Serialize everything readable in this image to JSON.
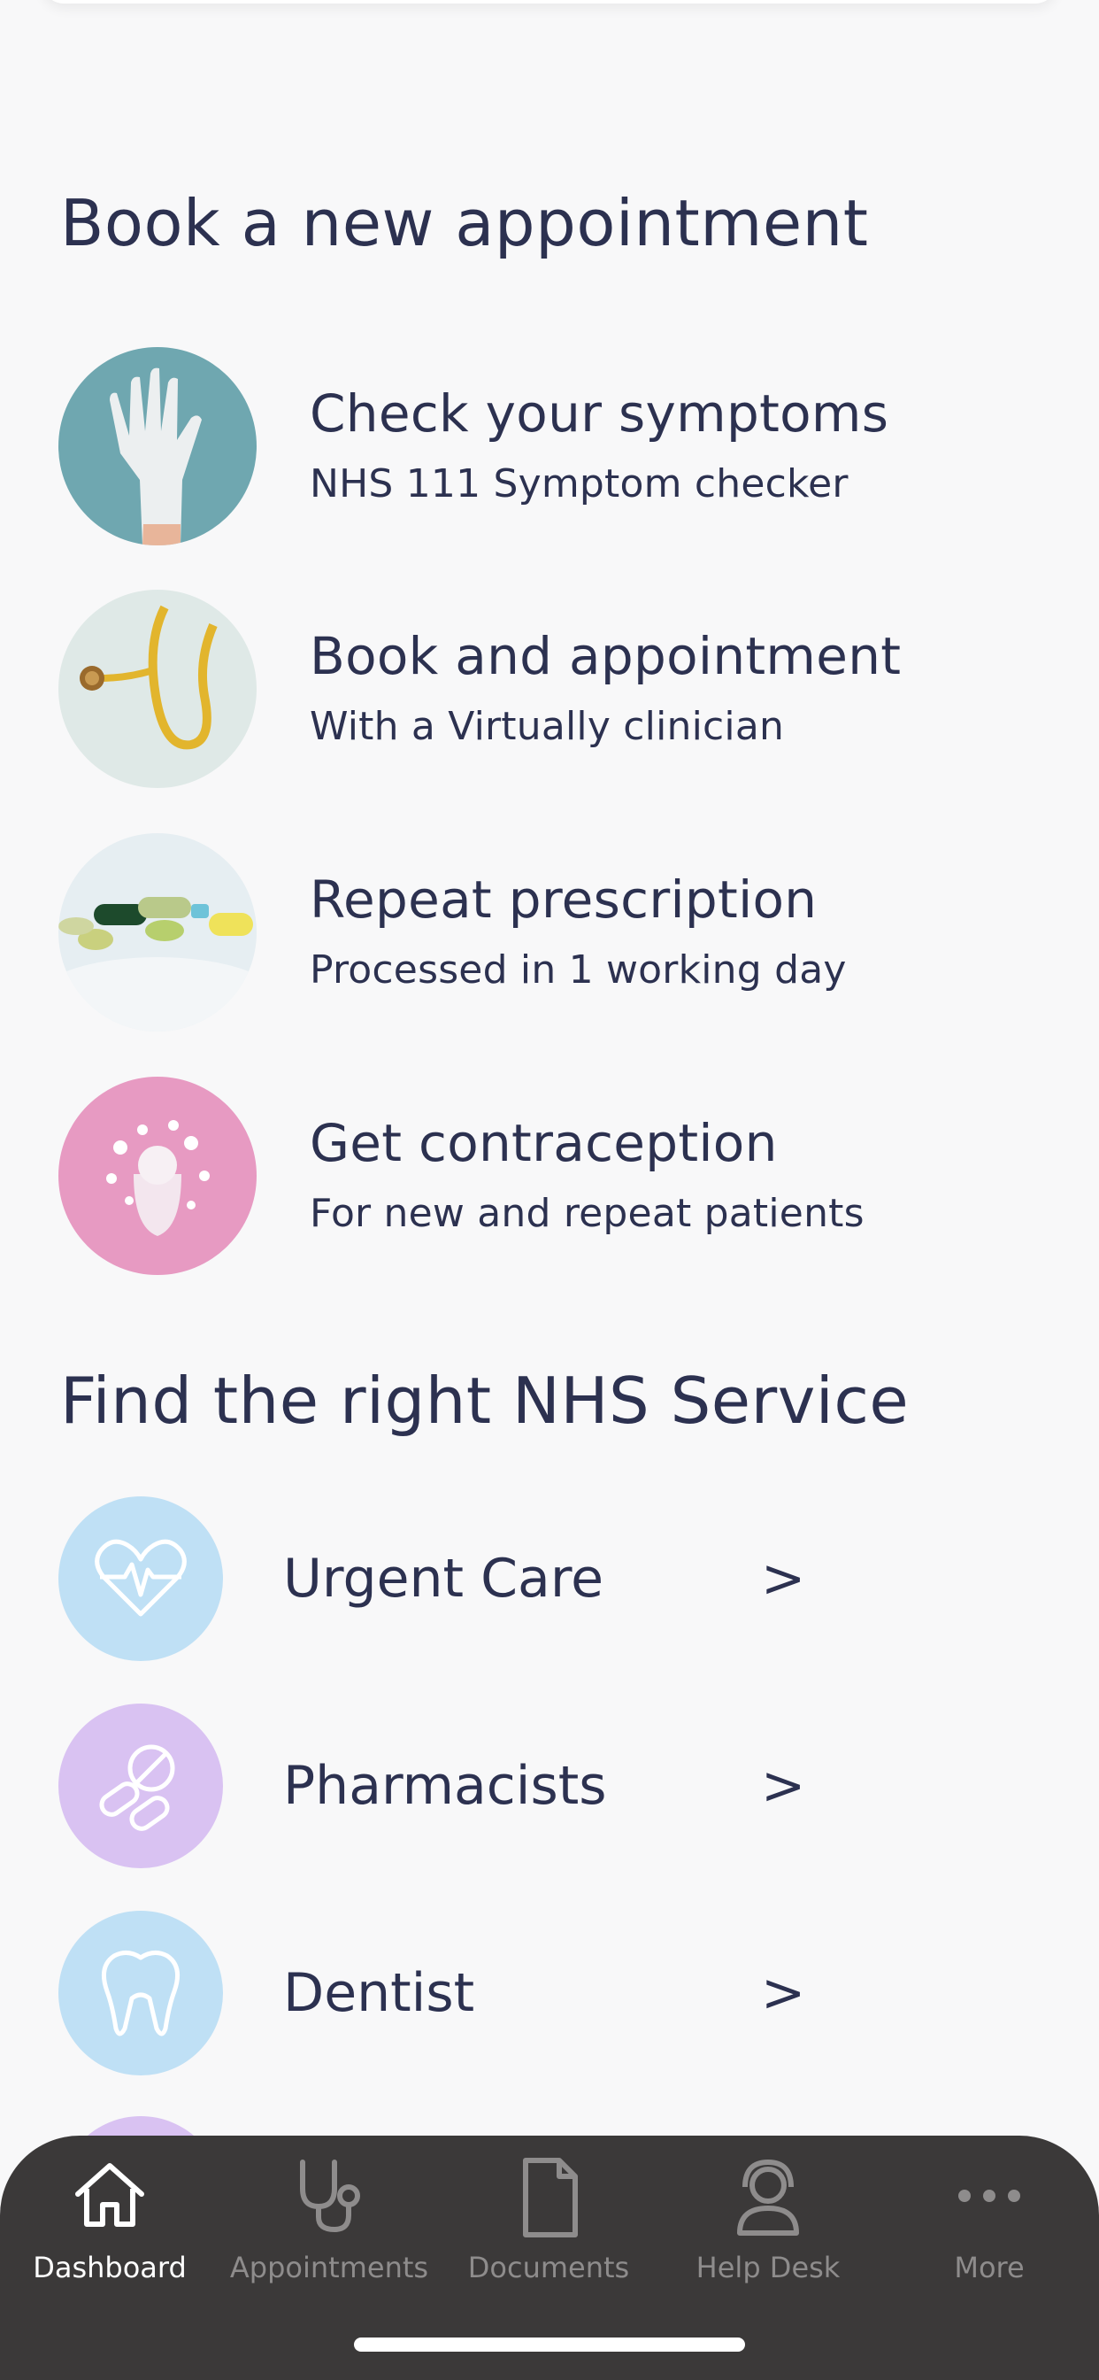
{
  "colors": {
    "background": "#f8f8f9",
    "text": "#2c3150",
    "tabbar": "#3b3939",
    "tab_active": "#ffffff",
    "tab_inactive": "#8e8c8c",
    "urgent_care_bg": "#bfe0f5",
    "pharmacists_bg": "#d9c2f2",
    "dentist_bg": "#bfe0f5"
  },
  "booking": {
    "title": "Book a new appointment",
    "items": [
      {
        "title": "Check your symptoms",
        "subtitle": "NHS 111 Symptom checker",
        "image": "glove-photo"
      },
      {
        "title": "Book and appointment",
        "subtitle": "With a Virtually clinician",
        "image": "stethoscope-photo"
      },
      {
        "title": "Repeat prescription",
        "subtitle": "Processed in 1 working day",
        "image": "pills-photo"
      },
      {
        "title": "Get contraception",
        "subtitle": "For new and repeat patients",
        "image": "menstrual-cup-photo"
      }
    ]
  },
  "services": {
    "title": "Find the right NHS Service",
    "items": [
      {
        "label": "Urgent Care",
        "chevron": ">",
        "icon": "heartbeat-icon"
      },
      {
        "label": "Pharmacists",
        "chevron": ">",
        "icon": "pills-icon"
      },
      {
        "label": "Dentist",
        "chevron": ">",
        "icon": "tooth-icon"
      }
    ]
  },
  "tabbar": {
    "tabs": [
      {
        "label": "Dashboard",
        "icon": "home-icon",
        "active": true
      },
      {
        "label": "Appointments",
        "icon": "stethoscope-icon",
        "active": false
      },
      {
        "label": "Documents",
        "icon": "document-icon",
        "active": false
      },
      {
        "label": "Help Desk",
        "icon": "headset-icon",
        "active": false
      },
      {
        "label": "More",
        "icon": "more-icon",
        "active": false
      }
    ]
  }
}
